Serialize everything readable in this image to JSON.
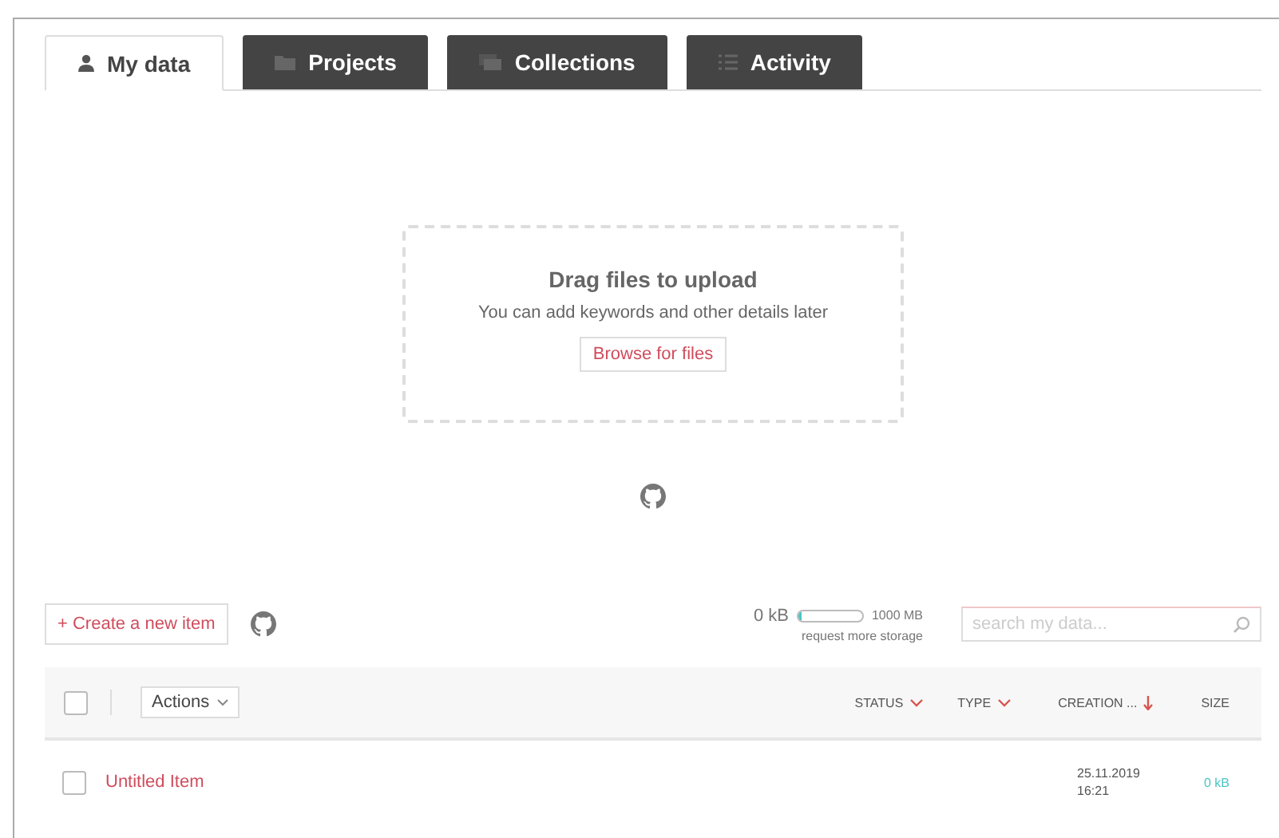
{
  "tabs": [
    {
      "label": "My data",
      "selected": true
    },
    {
      "label": "Projects",
      "selected": false
    },
    {
      "label": "Collections",
      "selected": false
    },
    {
      "label": "Activity",
      "selected": false
    }
  ],
  "upload": {
    "title": "Drag files to upload",
    "hint": "You can add keywords and other details later",
    "button": "Browse for files"
  },
  "toolbar": {
    "create_button": "+ Create a new item",
    "storage": {
      "used": "0 kB",
      "level": 0.05,
      "limit": "1000 MB",
      "request_link": "request more storage"
    },
    "search": {
      "placeholder": "search my data..."
    }
  },
  "table": {
    "select_all_checked": false,
    "actions": "Actions",
    "columns": [
      {
        "label": "STATUS"
      },
      {
        "label": "TYPE"
      },
      {
        "label": "CREATION ..."
      },
      {
        "label": "SIZE"
      }
    ],
    "rows": [
      {
        "title": "Untitled Item",
        "checked": false,
        "created_date": "25.11.2019",
        "created_time": "16:21",
        "size": "0 kB"
      }
    ]
  }
}
